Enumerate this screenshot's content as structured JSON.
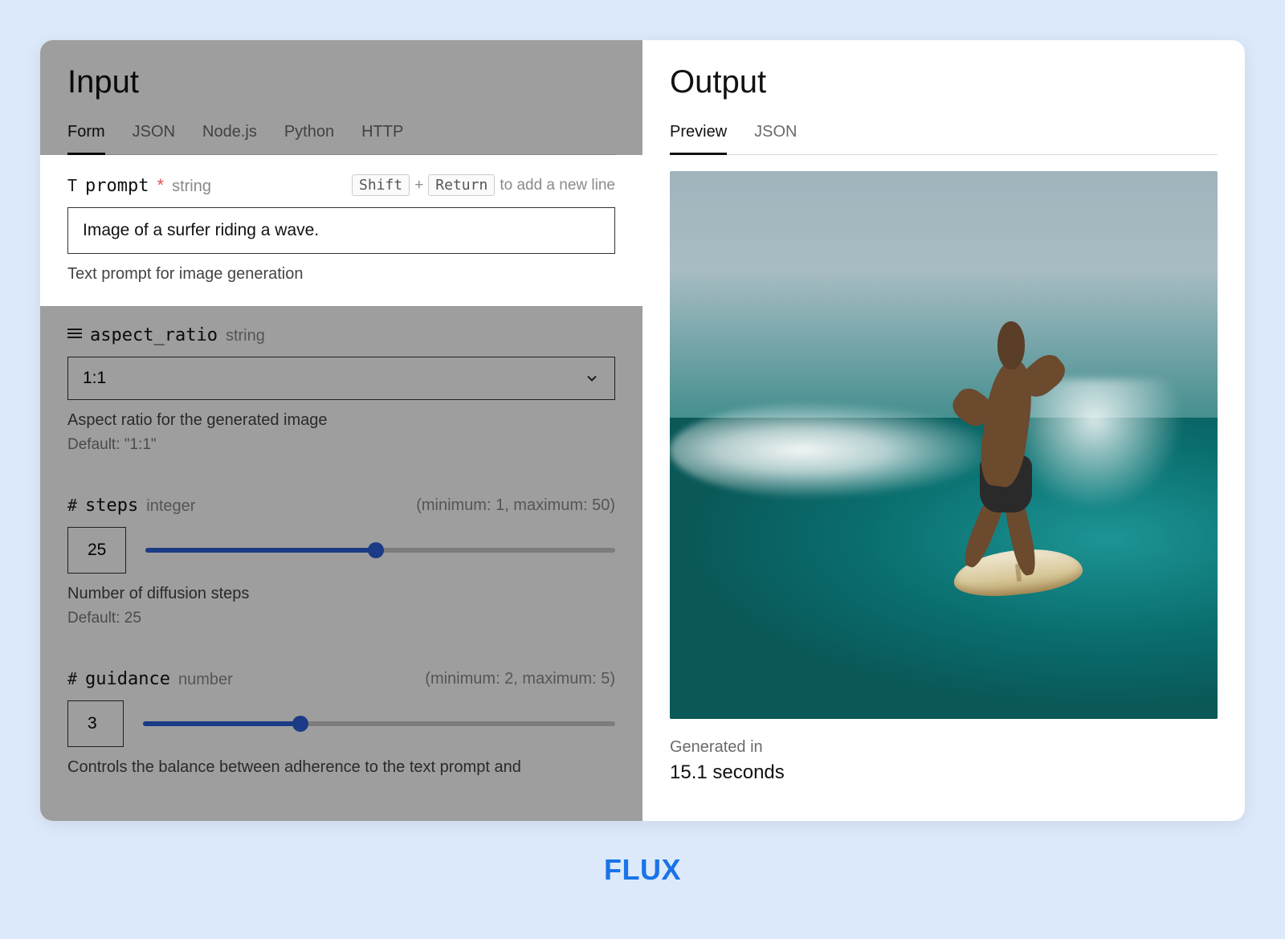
{
  "input": {
    "title": "Input",
    "tabs": [
      "Form",
      "JSON",
      "Node.js",
      "Python",
      "HTTP"
    ],
    "active_tab": 0,
    "prompt": {
      "icon": "T",
      "name": "prompt",
      "required": "*",
      "type": "string",
      "kbd_shift": "Shift",
      "kbd_plus": "+",
      "kbd_return": "Return",
      "hint_suffix": "to add a new line",
      "value": "Image of a surfer riding a wave.",
      "desc": "Text prompt for image generation"
    },
    "aspect_ratio": {
      "name": "aspect_ratio",
      "type": "string",
      "value": "1:1",
      "desc": "Aspect ratio for the generated image",
      "default": "Default: \"1:1\""
    },
    "steps": {
      "icon": "#",
      "name": "steps",
      "type": "integer",
      "range": "(minimum: 1, maximum: 50)",
      "value": "25",
      "min": 1,
      "max": 50,
      "desc": "Number of diffusion steps",
      "default": "Default: 25"
    },
    "guidance": {
      "icon": "#",
      "name": "guidance",
      "type": "number",
      "range": "(minimum: 2, maximum: 5)",
      "value": "3",
      "min": 2,
      "max": 5,
      "desc": "Controls the balance between adherence to the text prompt and"
    }
  },
  "output": {
    "title": "Output",
    "tabs": [
      "Preview",
      "JSON"
    ],
    "active_tab": 0,
    "gen_label": "Generated in",
    "gen_value": "15.1 seconds"
  },
  "brand": "FLUX"
}
